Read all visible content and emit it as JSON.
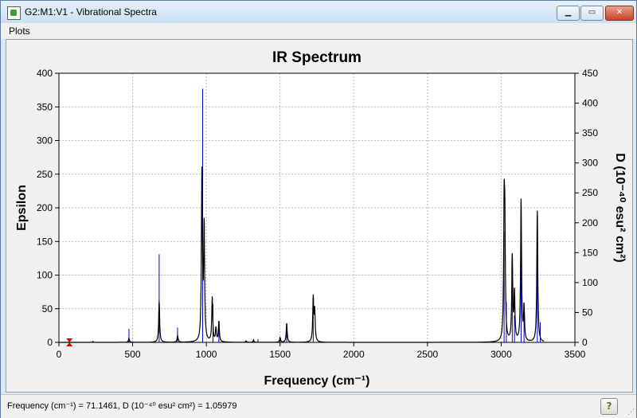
{
  "window": {
    "title": "G2:M1:V1 - Vibrational Spectra",
    "minimize_label": "▁",
    "maximize_label": "▭",
    "close_label": "✕"
  },
  "menu": {
    "items": [
      {
        "label": "Plots"
      }
    ]
  },
  "status": {
    "readout": "Frequency (cm⁻¹) = 71.1461, D (10⁻⁴⁰ esu² cm²) = 1.05979",
    "help_label": "?"
  },
  "chart_data": {
    "type": "line",
    "title": "IR Spectrum",
    "xlabel": "Frequency (cm⁻¹)",
    "ylabel": "Epsilon",
    "y2label": "D (10⁻⁴⁰ esu² cm²)",
    "xlim": [
      0,
      3500
    ],
    "ylim": [
      0,
      400
    ],
    "y2lim": [
      0,
      450
    ],
    "x_ticks": [
      0,
      500,
      1000,
      1500,
      2000,
      2500,
      3000,
      3500
    ],
    "y_ticks": [
      0,
      50,
      100,
      150,
      200,
      250,
      300,
      350,
      400
    ],
    "y2_ticks": [
      0,
      50,
      100,
      150,
      200,
      250,
      300,
      350,
      400,
      450
    ],
    "grid": true,
    "series": [
      {
        "kind": "spectrum_curve",
        "color": "#000000",
        "peaks": [
          {
            "x": 230,
            "y": 1
          },
          {
            "x": 475,
            "y": 6
          },
          {
            "x": 680,
            "y": 60
          },
          {
            "x": 805,
            "y": 10
          },
          {
            "x": 970,
            "y": 250
          },
          {
            "x": 985,
            "y": 168
          },
          {
            "x": 1040,
            "y": 66
          },
          {
            "x": 1065,
            "y": 20
          },
          {
            "x": 1085,
            "y": 30
          },
          {
            "x": 1270,
            "y": 2
          },
          {
            "x": 1320,
            "y": 3
          },
          {
            "x": 1500,
            "y": 7
          },
          {
            "x": 1545,
            "y": 28
          },
          {
            "x": 1725,
            "y": 65
          },
          {
            "x": 1735,
            "y": 45
          },
          {
            "x": 3020,
            "y": 180
          },
          {
            "x": 3025,
            "y": 145
          },
          {
            "x": 3075,
            "y": 125
          },
          {
            "x": 3090,
            "y": 70
          },
          {
            "x": 3135,
            "y": 210
          },
          {
            "x": 3155,
            "y": 50
          },
          {
            "x": 3245,
            "y": 195
          }
        ]
      },
      {
        "kind": "stick",
        "color": "#0000cc",
        "sticks": [
          {
            "x": 230,
            "y": 2
          },
          {
            "x": 475,
            "y": 20
          },
          {
            "x": 680,
            "y": 131
          },
          {
            "x": 805,
            "y": 22
          },
          {
            "x": 975,
            "y": 377
          },
          {
            "x": 1045,
            "y": 57
          },
          {
            "x": 1085,
            "y": 30
          },
          {
            "x": 1270,
            "y": 3
          },
          {
            "x": 1320,
            "y": 5
          },
          {
            "x": 1350,
            "y": 5
          },
          {
            "x": 1500,
            "y": 8
          },
          {
            "x": 1545,
            "y": 26
          },
          {
            "x": 1725,
            "y": 62
          },
          {
            "x": 3020,
            "y": 165
          },
          {
            "x": 3035,
            "y": 60
          },
          {
            "x": 3075,
            "y": 110
          },
          {
            "x": 3090,
            "y": 40
          },
          {
            "x": 3135,
            "y": 205
          },
          {
            "x": 3155,
            "y": 50
          },
          {
            "x": 3245,
            "y": 160
          },
          {
            "x": 3265,
            "y": 30
          }
        ]
      }
    ],
    "marker": {
      "x": 71.1461,
      "y": 0,
      "color": "#dd0000"
    }
  }
}
